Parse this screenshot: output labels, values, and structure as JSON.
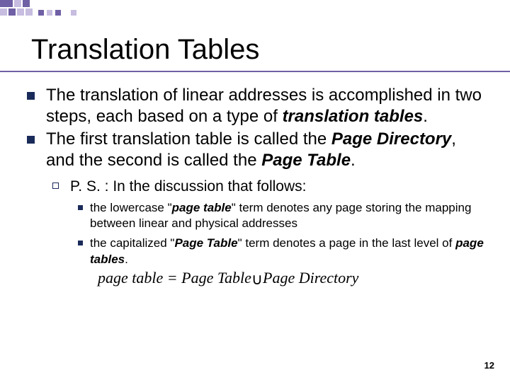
{
  "title": "Translation Tables",
  "bullets": {
    "b1_pre": "The translation of linear addresses is accomplished in two steps, each based on a type of ",
    "b1_em": "translation tables",
    "b1_post": ".",
    "b2_pre": "The first translation table is called the ",
    "b2_em1": "Page Directory",
    "b2_mid": ", and the second is called the ",
    "b2_em2": "Page Table",
    "b2_post": ".",
    "ps_label": "P. S. :",
    "ps_text": " In the discussion that follows:",
    "sb1_pre": "the lowercase \"",
    "sb1_em": "page table",
    "sb1_post": "\" term denotes any page storing the mapping between linear and physical addresses",
    "sb2_pre": "the capitalized \"",
    "sb2_em": "Page Table",
    "sb2_mid": "\" term denotes a page in the last level of ",
    "sb2_em2": "page tables",
    "sb2_post": "."
  },
  "equation": {
    "lhs": "page table",
    "eq": "  =  ",
    "r1": "Page Table",
    "cup": " ∪ ",
    "r2": "Page Directory"
  },
  "page_number": "12"
}
